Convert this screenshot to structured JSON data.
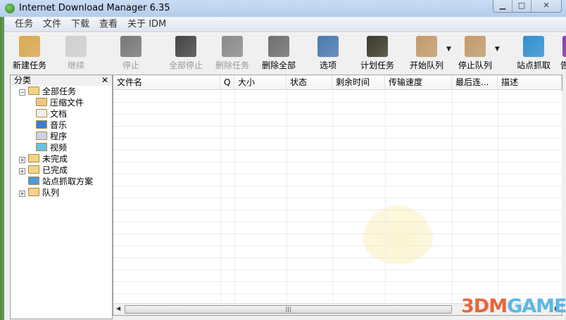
{
  "window": {
    "title": "Internet Download Manager 6.35",
    "minimize": "▁",
    "maximize": "□",
    "close": "✕"
  },
  "menu": [
    "任务",
    "文件",
    "下载",
    "查看",
    "关于 IDM"
  ],
  "toolbar": [
    {
      "id": "new-task",
      "label": "新建任务",
      "enabled": true,
      "color": "#d9a851"
    },
    {
      "id": "resume",
      "label": "继续",
      "enabled": false,
      "color": "#cfcfcf"
    },
    {
      "id": "stop",
      "label": "停止",
      "enabled": false,
      "color": "#777777"
    },
    {
      "id": "stop-all",
      "label": "全部停止",
      "enabled": false,
      "color": "#444444"
    },
    {
      "id": "delete-task",
      "label": "删除任务",
      "enabled": false,
      "color": "#8a8a8a"
    },
    {
      "id": "delete-all",
      "label": "删除全部",
      "enabled": true,
      "color": "#6e6e6e"
    },
    {
      "id": "options",
      "label": "选项",
      "enabled": true,
      "color": "#4a78b0"
    },
    {
      "id": "scheduler",
      "label": "计划任务",
      "enabled": true,
      "color": "#3a3a2a"
    },
    {
      "id": "start-queue",
      "label": "开始队列",
      "enabled": true,
      "color": "#c39a6a",
      "dropdown": true
    },
    {
      "id": "stop-queue",
      "label": "停止队列",
      "enabled": true,
      "color": "#c39a6a",
      "dropdown": true
    },
    {
      "id": "site-grabber",
      "label": "站点抓取",
      "enabled": true,
      "color": "#2f8fd0"
    },
    {
      "id": "tell-friend",
      "label": "告诉朋",
      "enabled": true,
      "color": "#8a3bb0"
    }
  ],
  "sidebar": {
    "title": "分类",
    "close": "✕",
    "tree": [
      {
        "label": "全部任务",
        "level": 0,
        "expander": "−",
        "icon": "folder-open-icon",
        "color": "#f1d48a"
      },
      {
        "label": "压缩文件",
        "level": 1,
        "icon": "zip-icon",
        "color": "#e8c888"
      },
      {
        "label": "文档",
        "level": 1,
        "icon": "document-icon",
        "color": "#eeeeee"
      },
      {
        "label": "音乐",
        "level": 1,
        "icon": "music-icon",
        "color": "#3a7fd0"
      },
      {
        "label": "程序",
        "level": 1,
        "icon": "program-icon",
        "color": "#c8d4e8"
      },
      {
        "label": "视频",
        "level": 1,
        "icon": "video-icon",
        "color": "#6cc0e8"
      },
      {
        "label": "未完成",
        "level": 0,
        "expander": "+",
        "icon": "folder-download-icon",
        "color": "#f1d48a"
      },
      {
        "label": "已完成",
        "level": 0,
        "expander": "+",
        "icon": "folder-check-icon",
        "color": "#f1d48a"
      },
      {
        "label": "站点抓取方案",
        "level": 0,
        "icon": "ie-folder-icon",
        "color": "#4a9ae0"
      },
      {
        "label": "队列",
        "level": 0,
        "expander": "+",
        "icon": "folders-icon",
        "color": "#f1d48a"
      }
    ]
  },
  "list": {
    "columns": [
      {
        "label": "文件名",
        "w": 152
      },
      {
        "label": "Q",
        "w": 20
      },
      {
        "label": "大小",
        "w": 74
      },
      {
        "label": "状态",
        "w": 65
      },
      {
        "label": "剩余时间",
        "w": 75
      },
      {
        "label": "传输速度",
        "w": 95
      },
      {
        "label": "最后连...",
        "w": 65
      },
      {
        "label": "描述",
        "w": 91
      }
    ],
    "scroll_thumb": "|||",
    "scroll_left": "◀",
    "scroll_right": "▶"
  },
  "watermark": {
    "part1": "3DM",
    "part2": "GAME"
  }
}
